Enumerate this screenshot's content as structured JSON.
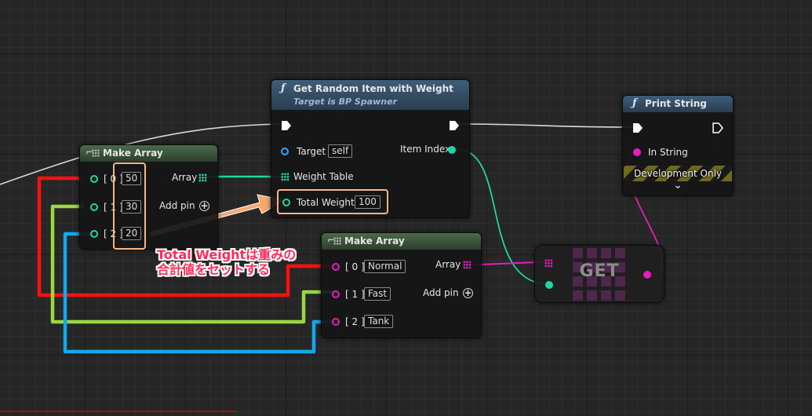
{
  "nodes": {
    "get_random": {
      "title": "Get Random Item with Weight",
      "subtitle": "Target is BP Spawner",
      "target_label": "Target",
      "target_value": "self",
      "item_index_label": "Item Index",
      "weight_table_label": "Weight Table",
      "total_weight_label": "Total Weight",
      "total_weight_value": "100"
    },
    "make_array_1": {
      "title": "Make Array",
      "array_label": "Array",
      "add_pin_label": "Add pin",
      "elements": [
        {
          "index": "[ 0 ]",
          "value": "50"
        },
        {
          "index": "[ 1 ]",
          "value": "30"
        },
        {
          "index": "[ 2 ]",
          "value": "20"
        }
      ]
    },
    "make_array_2": {
      "title": "Make Array",
      "array_label": "Array",
      "add_pin_label": "Add pin",
      "elements": [
        {
          "index": "[ 0 ]",
          "value": "Normal"
        },
        {
          "index": "[ 1 ]",
          "value": "Fast"
        },
        {
          "index": "[ 2 ]",
          "value": "Tank"
        }
      ]
    },
    "get": {
      "title": "GET"
    },
    "print_string": {
      "title": "Print String",
      "in_string_label": "In String",
      "dev_only_label": "Development Only",
      "expand_glyph": "⌄"
    }
  },
  "annotation": {
    "line1": "Total Weightは重みの",
    "line2": "合計値をセットする",
    "color": "#ff2b5a"
  },
  "icons": {
    "function": "function-icon",
    "make_array": "array-grid-icon",
    "exec": "exec-arrow-icon",
    "add": "plus-circle-icon"
  },
  "colors": {
    "exec_wire": "#e0e0e0",
    "int_wire": "#1ed6a4",
    "string_wire": "#e01fbc",
    "wire_red": "#ff1010",
    "wire_green": "#9ad840",
    "wire_blue": "#12a8ec",
    "target_pin": "#35a6ff",
    "highlight": "#f7b58a"
  }
}
